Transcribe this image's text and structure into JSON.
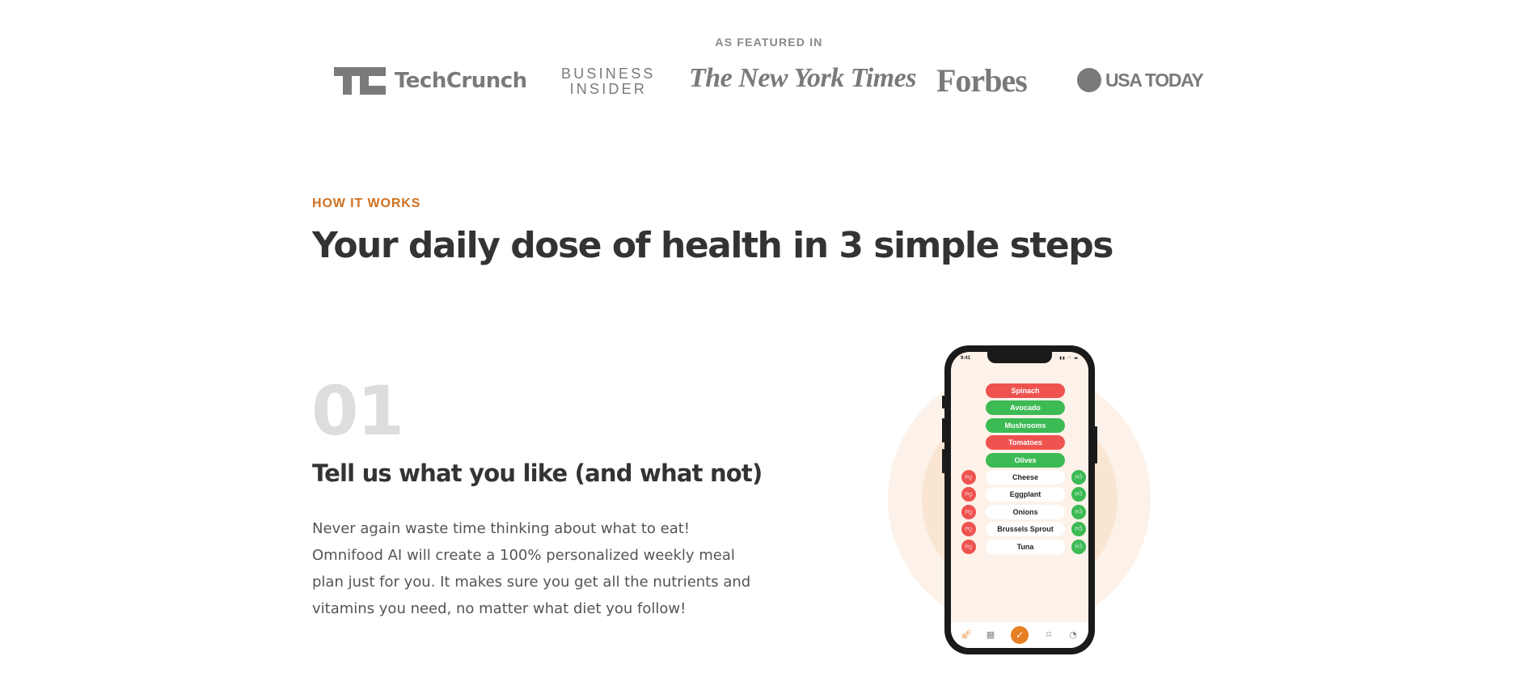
{
  "featured": {
    "label": "AS FEATURED IN",
    "logos": {
      "techcrunch": "TechCrunch",
      "business_insider_line1": "BUSINESS",
      "business_insider_line2": "INSIDER",
      "nyt": "The New York Times",
      "forbes": "Forbes",
      "usatoday": "USA TODAY"
    }
  },
  "how_it_works": {
    "subheading": "HOW IT WORKS",
    "heading": "Your daily dose of health in 3 simple steps"
  },
  "step": {
    "number": "01",
    "title": "Tell us what you like (and what not)",
    "description": "Never again waste time thinking about what to eat! Omnifood AI will create a 100% personalized weekly meal plan just for you. It makes sure you get all the nutrients and vitamins you need, no matter what diet you follow!"
  },
  "phone": {
    "time": "9:41",
    "status_icons": "▮▮ ◠ ▬",
    "selected_foods": [
      {
        "label": "Spinach",
        "liked": false
      },
      {
        "label": "Avocado",
        "liked": true
      },
      {
        "label": "Mushrooms",
        "liked": true
      },
      {
        "label": "Tomatoes",
        "liked": false
      },
      {
        "label": "Olives",
        "liked": true
      }
    ],
    "unrated_foods": [
      "Cheese",
      "Eggplant",
      "Onions",
      "Brussels Sprout",
      "Tuna"
    ],
    "icons": {
      "dislike": "thumbs-down-icon",
      "like": "thumbs-up-icon",
      "tabs": [
        "rocket-icon",
        "calendar-icon",
        "checkmark-icon",
        "bookmark-icon",
        "user-icon"
      ]
    },
    "colors": {
      "red": "#ef5350",
      "green": "#3cba54",
      "accent": "#e67e22"
    }
  },
  "colors": {
    "accent": "#cf711f",
    "circle_outer": "#fdf2e9",
    "circle_inner": "#fae5d3"
  }
}
